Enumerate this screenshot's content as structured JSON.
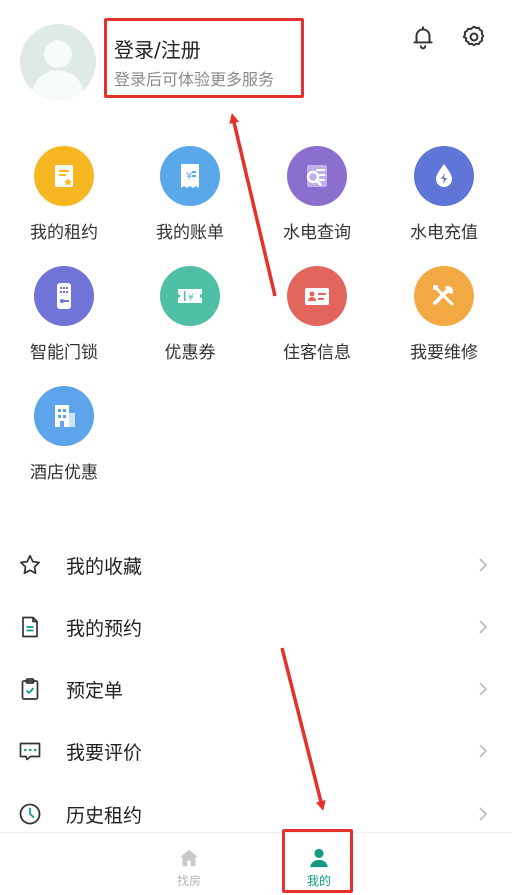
{
  "header": {
    "login_title": "登录/注册",
    "login_subtitle": "登录后可体验更多服务"
  },
  "grid": [
    {
      "label": "我的租约",
      "icon": "contract-icon",
      "color": "#f6b720"
    },
    {
      "label": "我的账单",
      "icon": "bill-icon",
      "color": "#5aa7ea"
    },
    {
      "label": "水电查询",
      "icon": "utility-query-icon",
      "color": "#8a6fcf"
    },
    {
      "label": "水电充值",
      "icon": "water-drop-icon",
      "color": "#5f76d6"
    },
    {
      "label": "智能门锁",
      "icon": "smart-lock-icon",
      "color": "#6f74d6"
    },
    {
      "label": "优惠券",
      "icon": "coupon-icon",
      "color": "#4fbfa6"
    },
    {
      "label": "住客信息",
      "icon": "id-card-icon",
      "color": "#e2655e"
    },
    {
      "label": "我要维修",
      "icon": "repair-tools-icon",
      "color": "#f2a944"
    },
    {
      "label": "酒店优惠",
      "icon": "hotel-icon",
      "color": "#5ea4ea"
    }
  ],
  "list": [
    {
      "label": "我的收藏",
      "icon": "star-icon"
    },
    {
      "label": "我的预约",
      "icon": "document-icon"
    },
    {
      "label": "预定单",
      "icon": "clipboard-check-icon"
    },
    {
      "label": "我要评价",
      "icon": "comment-icon"
    },
    {
      "label": "历史租约",
      "icon": "clock-icon"
    }
  ],
  "tabbar": {
    "find_label": "找房",
    "mine_label": "我的",
    "active_color": "#129a83",
    "inactive_color": "#b5b5b5"
  },
  "annotation_color": "#e5302c"
}
